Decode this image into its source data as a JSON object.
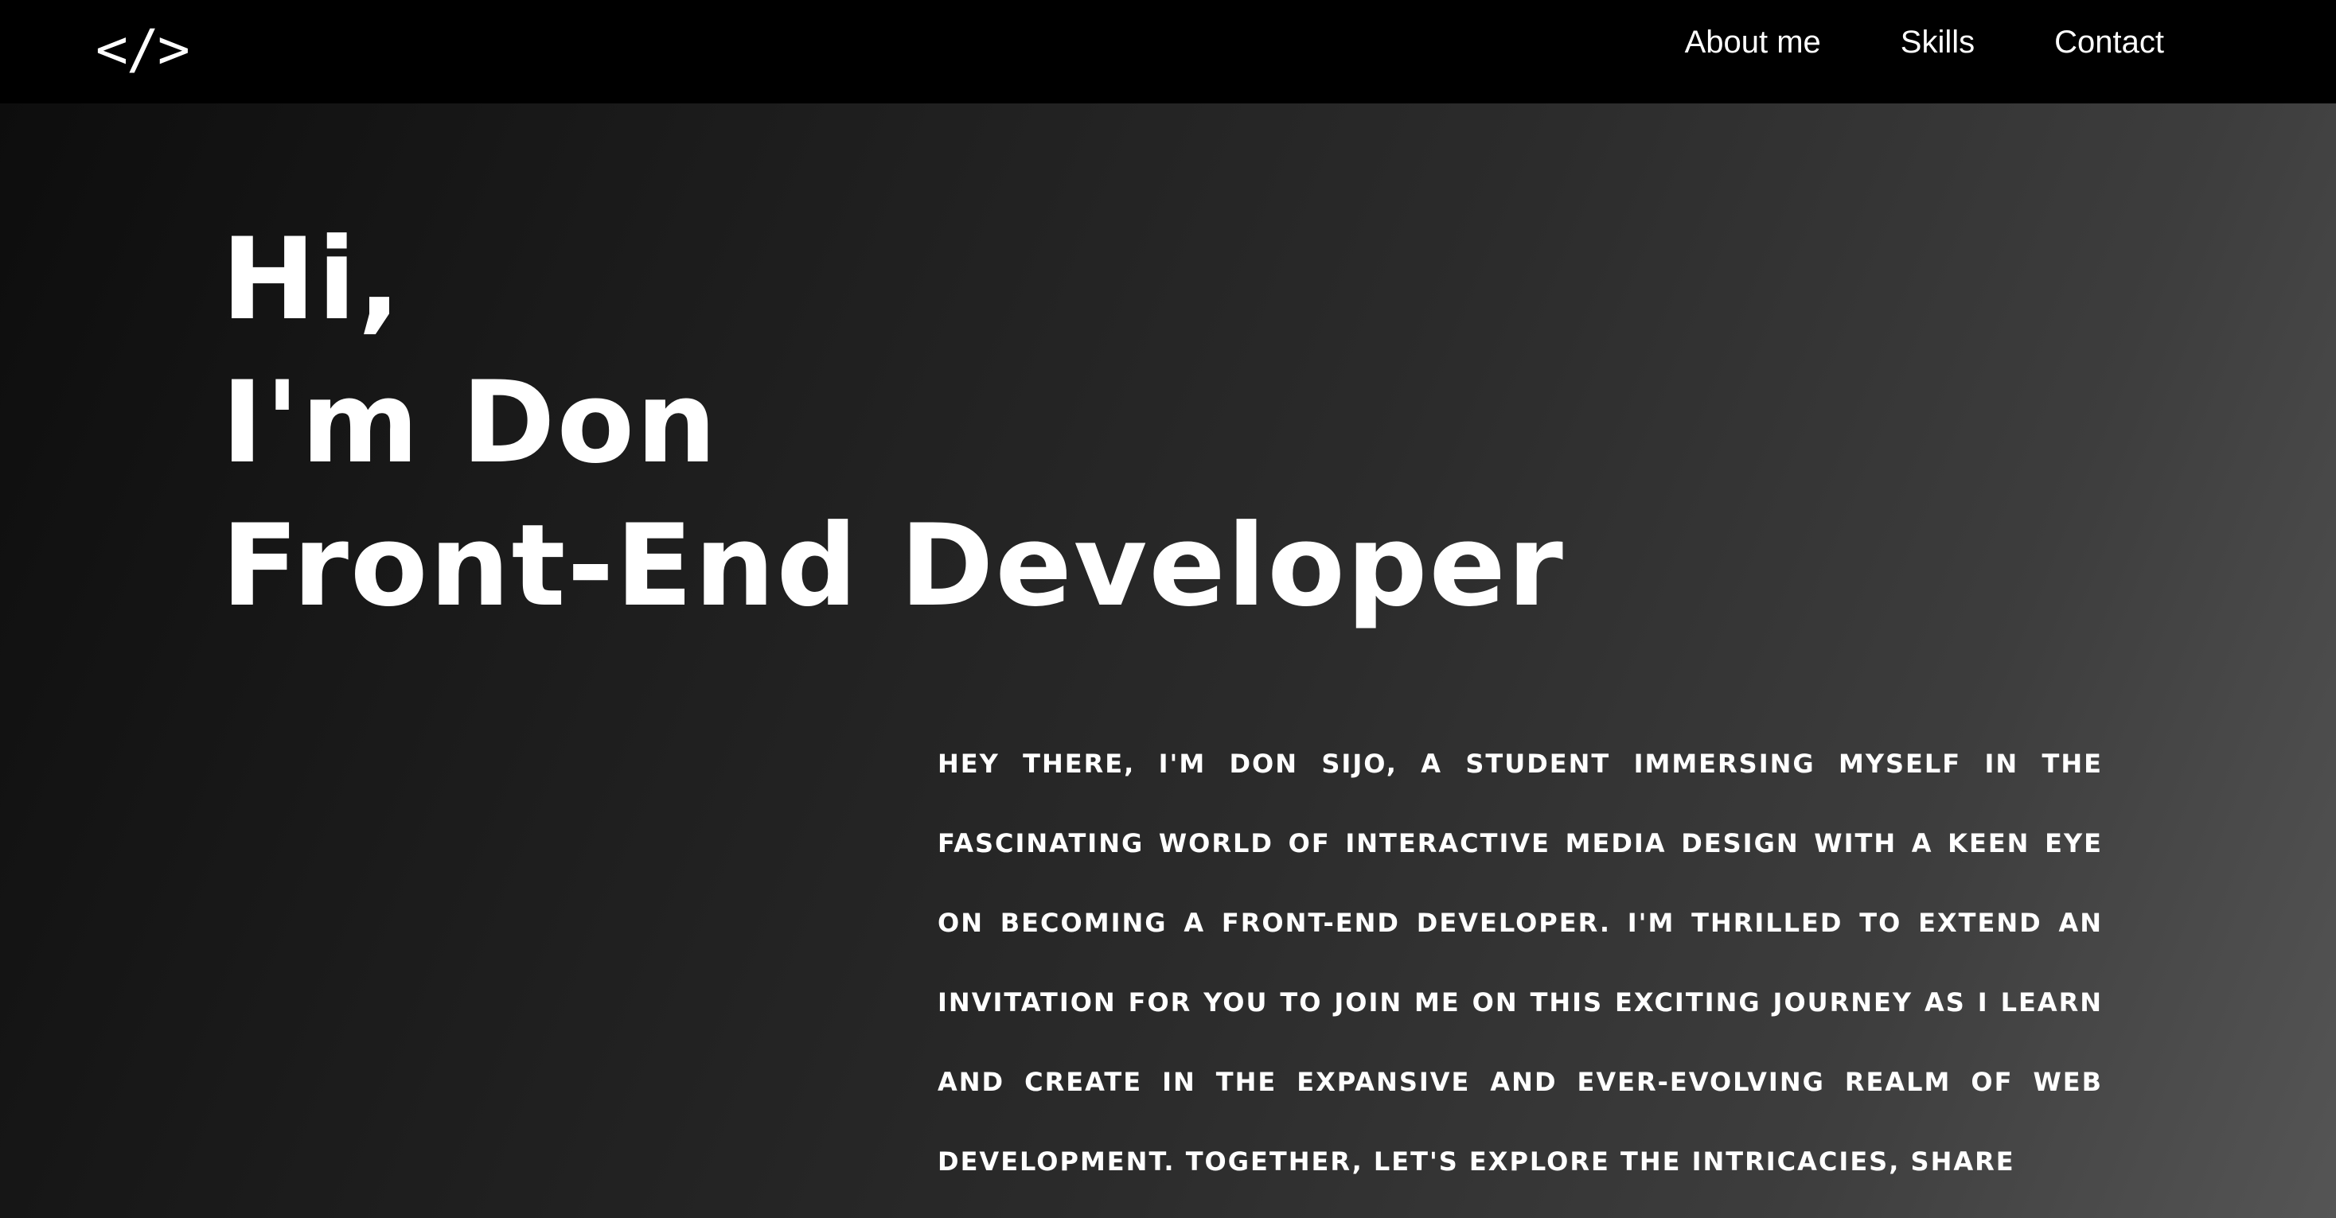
{
  "header": {
    "logo_text": "</>",
    "logo_icon": "code-brackets-icon",
    "nav": [
      {
        "label": "About me"
      },
      {
        "label": "Skills"
      },
      {
        "label": "Contact"
      }
    ]
  },
  "hero": {
    "greeting": "Hi,",
    "name_line": "I'm Don",
    "role_line": "Front-End Developer",
    "intro": "Hey there, I'm Don Sijo, a student immersing myself in the fascinating world of interactive media design with a keen eye on becoming a front-end developer. I'm thrilled to extend an invitation for you to join me on this exciting journey as I learn and create in the expansive and ever-evolving realm of web development. Together, let's explore the intricacies, share"
  },
  "colors": {
    "topbar_bg": "#000000",
    "gradient_start": "#0d0d0d",
    "gradient_end": "#555555",
    "text": "#ffffff"
  }
}
